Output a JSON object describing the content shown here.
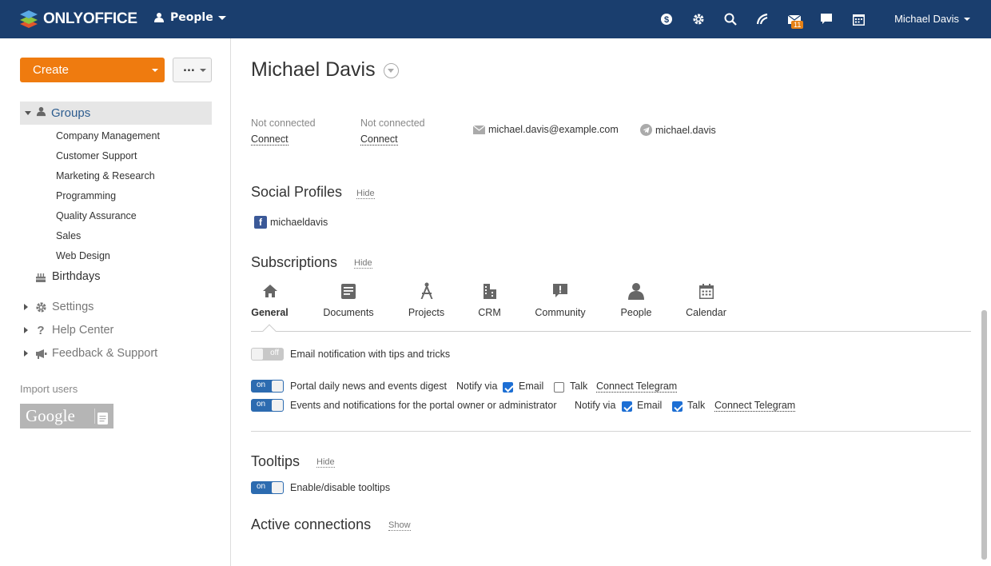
{
  "topbar": {
    "brand": "ONLYOFFICE",
    "module": "People",
    "mail_badge": "11",
    "user_name": "Michael Davis",
    "icons": [
      "currency-icon",
      "gear-icon",
      "search-icon",
      "feed-icon",
      "mail-icon",
      "chat-icon",
      "calendar-icon"
    ]
  },
  "sidebar": {
    "create_label": "Create",
    "more_label": "...",
    "groups_label": "Groups",
    "groups": [
      "Company Management",
      "Customer Support",
      "Marketing & Research",
      "Programming",
      "Quality Assurance",
      "Sales",
      "Web Design"
    ],
    "birthdays_label": "Birthdays",
    "settings_label": "Settings",
    "help_label": "Help Center",
    "feedback_label": "Feedback & Support",
    "import_label": "Import users",
    "google_label": "Google"
  },
  "profile": {
    "name": "Michael Davis",
    "contacts": [
      {
        "status": "Not connected",
        "action": "Connect"
      },
      {
        "status": "Not connected",
        "action": "Connect"
      }
    ],
    "email": "michael.davis@example.com",
    "telegram": "michael.davis"
  },
  "social": {
    "title": "Social Profiles",
    "toggle": "Hide",
    "facebook": "michaeldavis"
  },
  "subscriptions": {
    "title": "Subscriptions",
    "toggle": "Hide",
    "tabs": [
      "General",
      "Documents",
      "Projects",
      "CRM",
      "Community",
      "People",
      "Calendar"
    ],
    "active_tab": "General",
    "rows": [
      {
        "state": "off",
        "text": "Email notification with tips and tricks"
      },
      {
        "state": "on",
        "text": "Portal daily news and events digest",
        "notify_via": "Notify via",
        "email_label": "Email",
        "email_checked": true,
        "talk_label": "Talk",
        "talk_checked": false,
        "link": "Connect Telegram"
      },
      {
        "state": "on",
        "text": "Events and notifications for the portal owner or administrator",
        "notify_via": "Notify via",
        "email_label": "Email",
        "email_checked": true,
        "talk_label": "Talk",
        "talk_checked": true,
        "link": "Connect Telegram"
      }
    ]
  },
  "tooltips": {
    "title": "Tooltips",
    "toggle": "Hide",
    "state": "on",
    "text": "Enable/disable tooltips"
  },
  "connections": {
    "title": "Active connections",
    "toggle": "Show"
  },
  "colors": {
    "topbar": "#1a3e6e",
    "create": "#ef7b0f",
    "toggle_on": "#2c6bb0",
    "badge": "#e68116"
  }
}
